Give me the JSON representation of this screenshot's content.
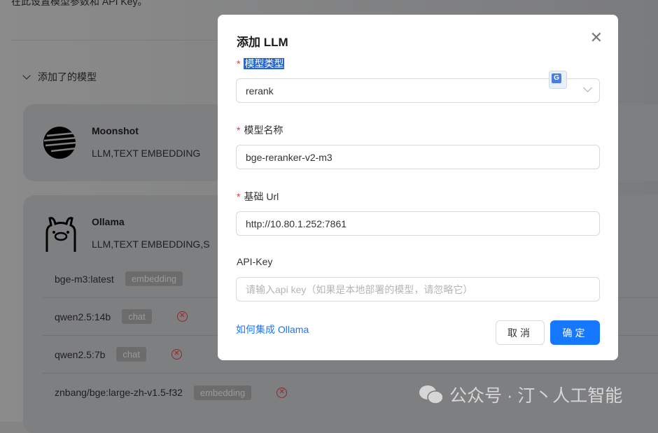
{
  "page": {
    "intro": "在此设置模型参数和 API Key。",
    "section_title": "添加了的模型",
    "providers": [
      {
        "name": "Moonshot",
        "tags": "LLM,TEXT EMBEDDING"
      },
      {
        "name": "Ollama",
        "tags": "LLM,TEXT EMBEDDING,S",
        "models": [
          {
            "name": "bge-m3:latest",
            "type": "embedding",
            "deletable": false
          },
          {
            "name": "qwen2.5:14b",
            "type": "chat",
            "deletable": true
          },
          {
            "name": "qwen2.5:7b",
            "type": "chat",
            "deletable": true
          },
          {
            "name": "znbang/bge:large-zh-v1.5-f32",
            "type": "embedding",
            "deletable": true
          }
        ]
      }
    ]
  },
  "modal": {
    "title": "添加 LLM",
    "model_type": {
      "label": "模型类型",
      "value": "rerank"
    },
    "model_name": {
      "label": "模型名称",
      "value": "bge-reranker-v2-m3"
    },
    "base_url": {
      "label": "基础 Url",
      "value": "http://10.80.1.252:7861"
    },
    "api_key": {
      "label": "API-Key",
      "placeholder": "请输入api key（如果是本地部署的模型，请忽略它）"
    },
    "help_link": "如何集成 Ollama",
    "cancel": "取消",
    "ok": "确定",
    "required_mark": "*"
  },
  "watermark": "公众号 · 汀丶人工智能",
  "colors": {
    "primary": "#1677ff",
    "danger": "#e0393e"
  }
}
